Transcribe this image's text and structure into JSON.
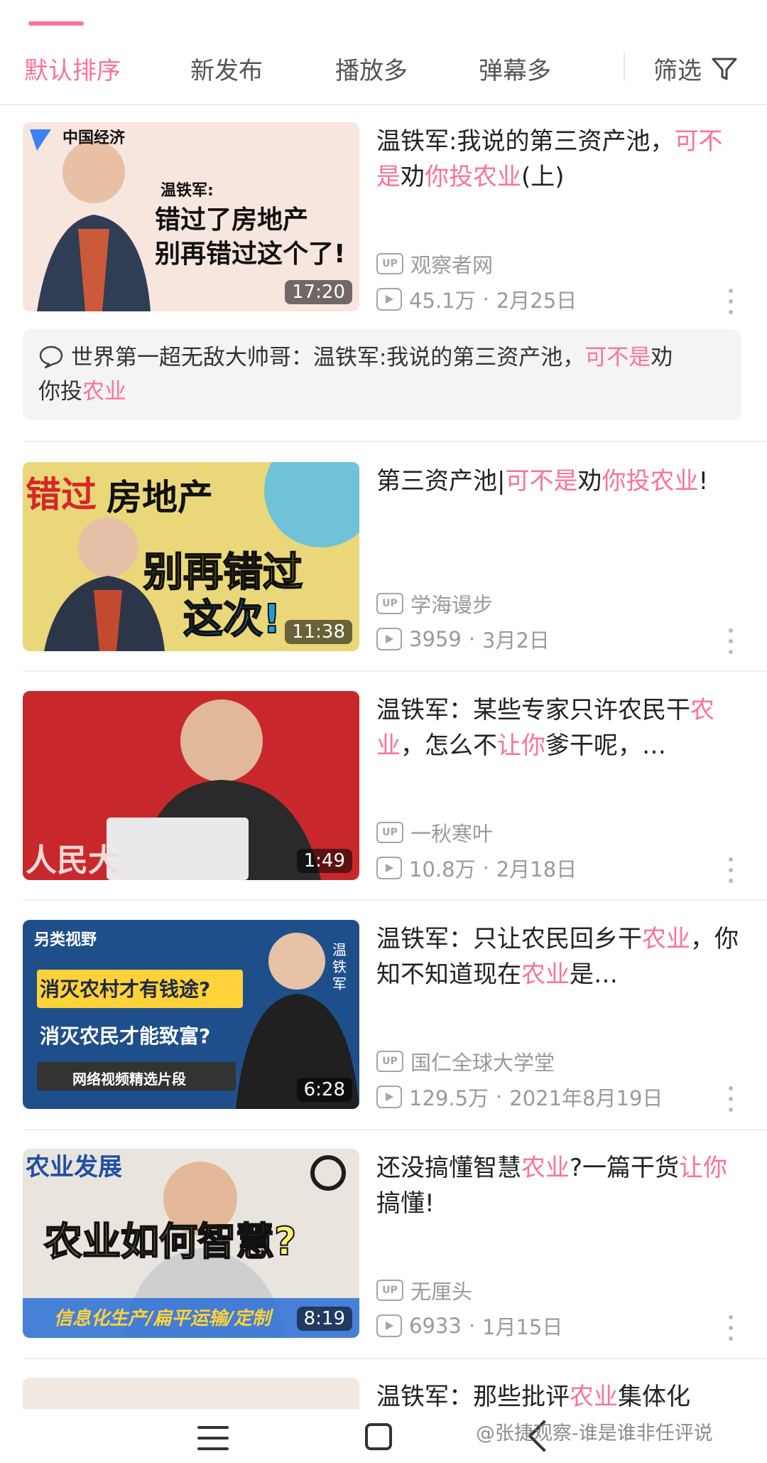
{
  "sort_tabs": [
    "默认排序",
    "新发布",
    "播放多",
    "弹幕多"
  ],
  "filter_label": "筛选",
  "comment": {
    "author": "世界第一超无敌大帅哥",
    "prefix": "：温铁军:我说的第三资产池，",
    "hl1": "可不是",
    "mid": "劝",
    "line2_pre": "你投",
    "hl2": "农业"
  },
  "videos": [
    {
      "title_parts": [
        {
          "t": "温铁军:我说的第三资产池，",
          "hl": false
        },
        {
          "t": "可不是",
          "hl": true
        },
        {
          "t": "劝",
          "hl": false
        },
        {
          "t": "你投农业",
          "hl": true
        },
        {
          "t": "(上)",
          "hl": false
        }
      ],
      "uploader": "观察者网",
      "views": "45.1万",
      "date": "2月25日",
      "duration": "17:20",
      "thumb_text": [
        "中国经济",
        "温铁军:",
        "错过了房地产",
        "别再错过这个了!"
      ]
    },
    {
      "title_parts": [
        {
          "t": "第三资产池|",
          "hl": false
        },
        {
          "t": "可不是",
          "hl": true
        },
        {
          "t": "劝",
          "hl": false
        },
        {
          "t": "你投农业",
          "hl": true
        },
        {
          "t": "!",
          "hl": false
        }
      ],
      "uploader": "学海谩步",
      "views": "3959",
      "date": "3月2日",
      "duration": "11:38",
      "thumb_text": [
        "错过",
        "房地产",
        "别再错过",
        "这次!"
      ]
    },
    {
      "title_parts": [
        {
          "t": "温铁军：某些专家只许农民干",
          "hl": false
        },
        {
          "t": "农业",
          "hl": true
        },
        {
          "t": "，怎么不",
          "hl": false
        },
        {
          "t": "让你",
          "hl": true
        },
        {
          "t": "爹干呢，…",
          "hl": false
        }
      ],
      "uploader": "一秋寒叶",
      "views": "10.8万",
      "date": "2月18日",
      "duration": "1:49",
      "thumb_text": [
        "人民大"
      ]
    },
    {
      "title_parts": [
        {
          "t": "温铁军：只让农民回乡干",
          "hl": false
        },
        {
          "t": "农业",
          "hl": true
        },
        {
          "t": "，你知不知道现在",
          "hl": false
        },
        {
          "t": "农业",
          "hl": true
        },
        {
          "t": "是…",
          "hl": false
        }
      ],
      "uploader": "国仁全球大学堂",
      "views": "129.5万",
      "date": "2021年8月19日",
      "duration": "6:28",
      "thumb_text": [
        "另类视野",
        "消灭农村才有钱途?",
        "消灭农民才能致富?",
        "网络视频精选片段",
        "温铁军"
      ]
    },
    {
      "title_parts": [
        {
          "t": "还没搞懂智慧",
          "hl": false
        },
        {
          "t": "农业",
          "hl": true
        },
        {
          "t": "?一篇干货",
          "hl": false
        },
        {
          "t": "让你",
          "hl": true
        },
        {
          "t": "搞懂!",
          "hl": false
        }
      ],
      "uploader": "无厘头",
      "views": "6933",
      "date": "1月15日",
      "duration": "8:19",
      "thumb_text": [
        "农业发展",
        "农业如何智慧?",
        "信息化生产/扁平运输/定制"
      ]
    },
    {
      "title_parts": [
        {
          "t": "温铁军：那些批评",
          "hl": false
        },
        {
          "t": "农业",
          "hl": true
        },
        {
          "t": "集体化",
          "hl": false
        }
      ]
    }
  ],
  "watermark": "@张捷观察-谁是谁非任评说",
  "colors": {
    "accent": "#fb7299"
  }
}
